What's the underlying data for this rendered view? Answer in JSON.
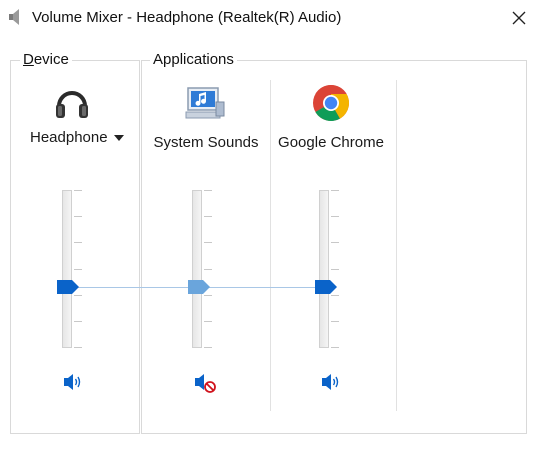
{
  "window": {
    "title": "Volume Mixer - Headphone (Realtek(R) Audio)",
    "icon": "speaker-icon",
    "close_icon": "close-icon"
  },
  "device_group": {
    "label_underlined": "D",
    "label_rest": "evice",
    "device": {
      "name": "Headphone",
      "icon": "headphones-icon",
      "selector_icon": "dropdown-caret-icon",
      "volume_percent": 40,
      "muted": false,
      "mute_icon": "speaker-on-icon"
    }
  },
  "applications_group": {
    "label": "Applications",
    "apps": [
      {
        "name": "System Sounds",
        "icon": "system-sounds-icon",
        "volume_percent": 40,
        "muted": true,
        "mute_icon": "speaker-muted-icon"
      },
      {
        "name": "Google Chrome",
        "icon": "chrome-icon",
        "volume_percent": 40,
        "muted": false,
        "mute_icon": "speaker-on-icon"
      }
    ]
  },
  "colors": {
    "accent_blue": "#0a63c9",
    "disabled_blue": "#6aa5dc",
    "mute_red": "#d0131d",
    "peak_line": "#a9c7e6"
  }
}
